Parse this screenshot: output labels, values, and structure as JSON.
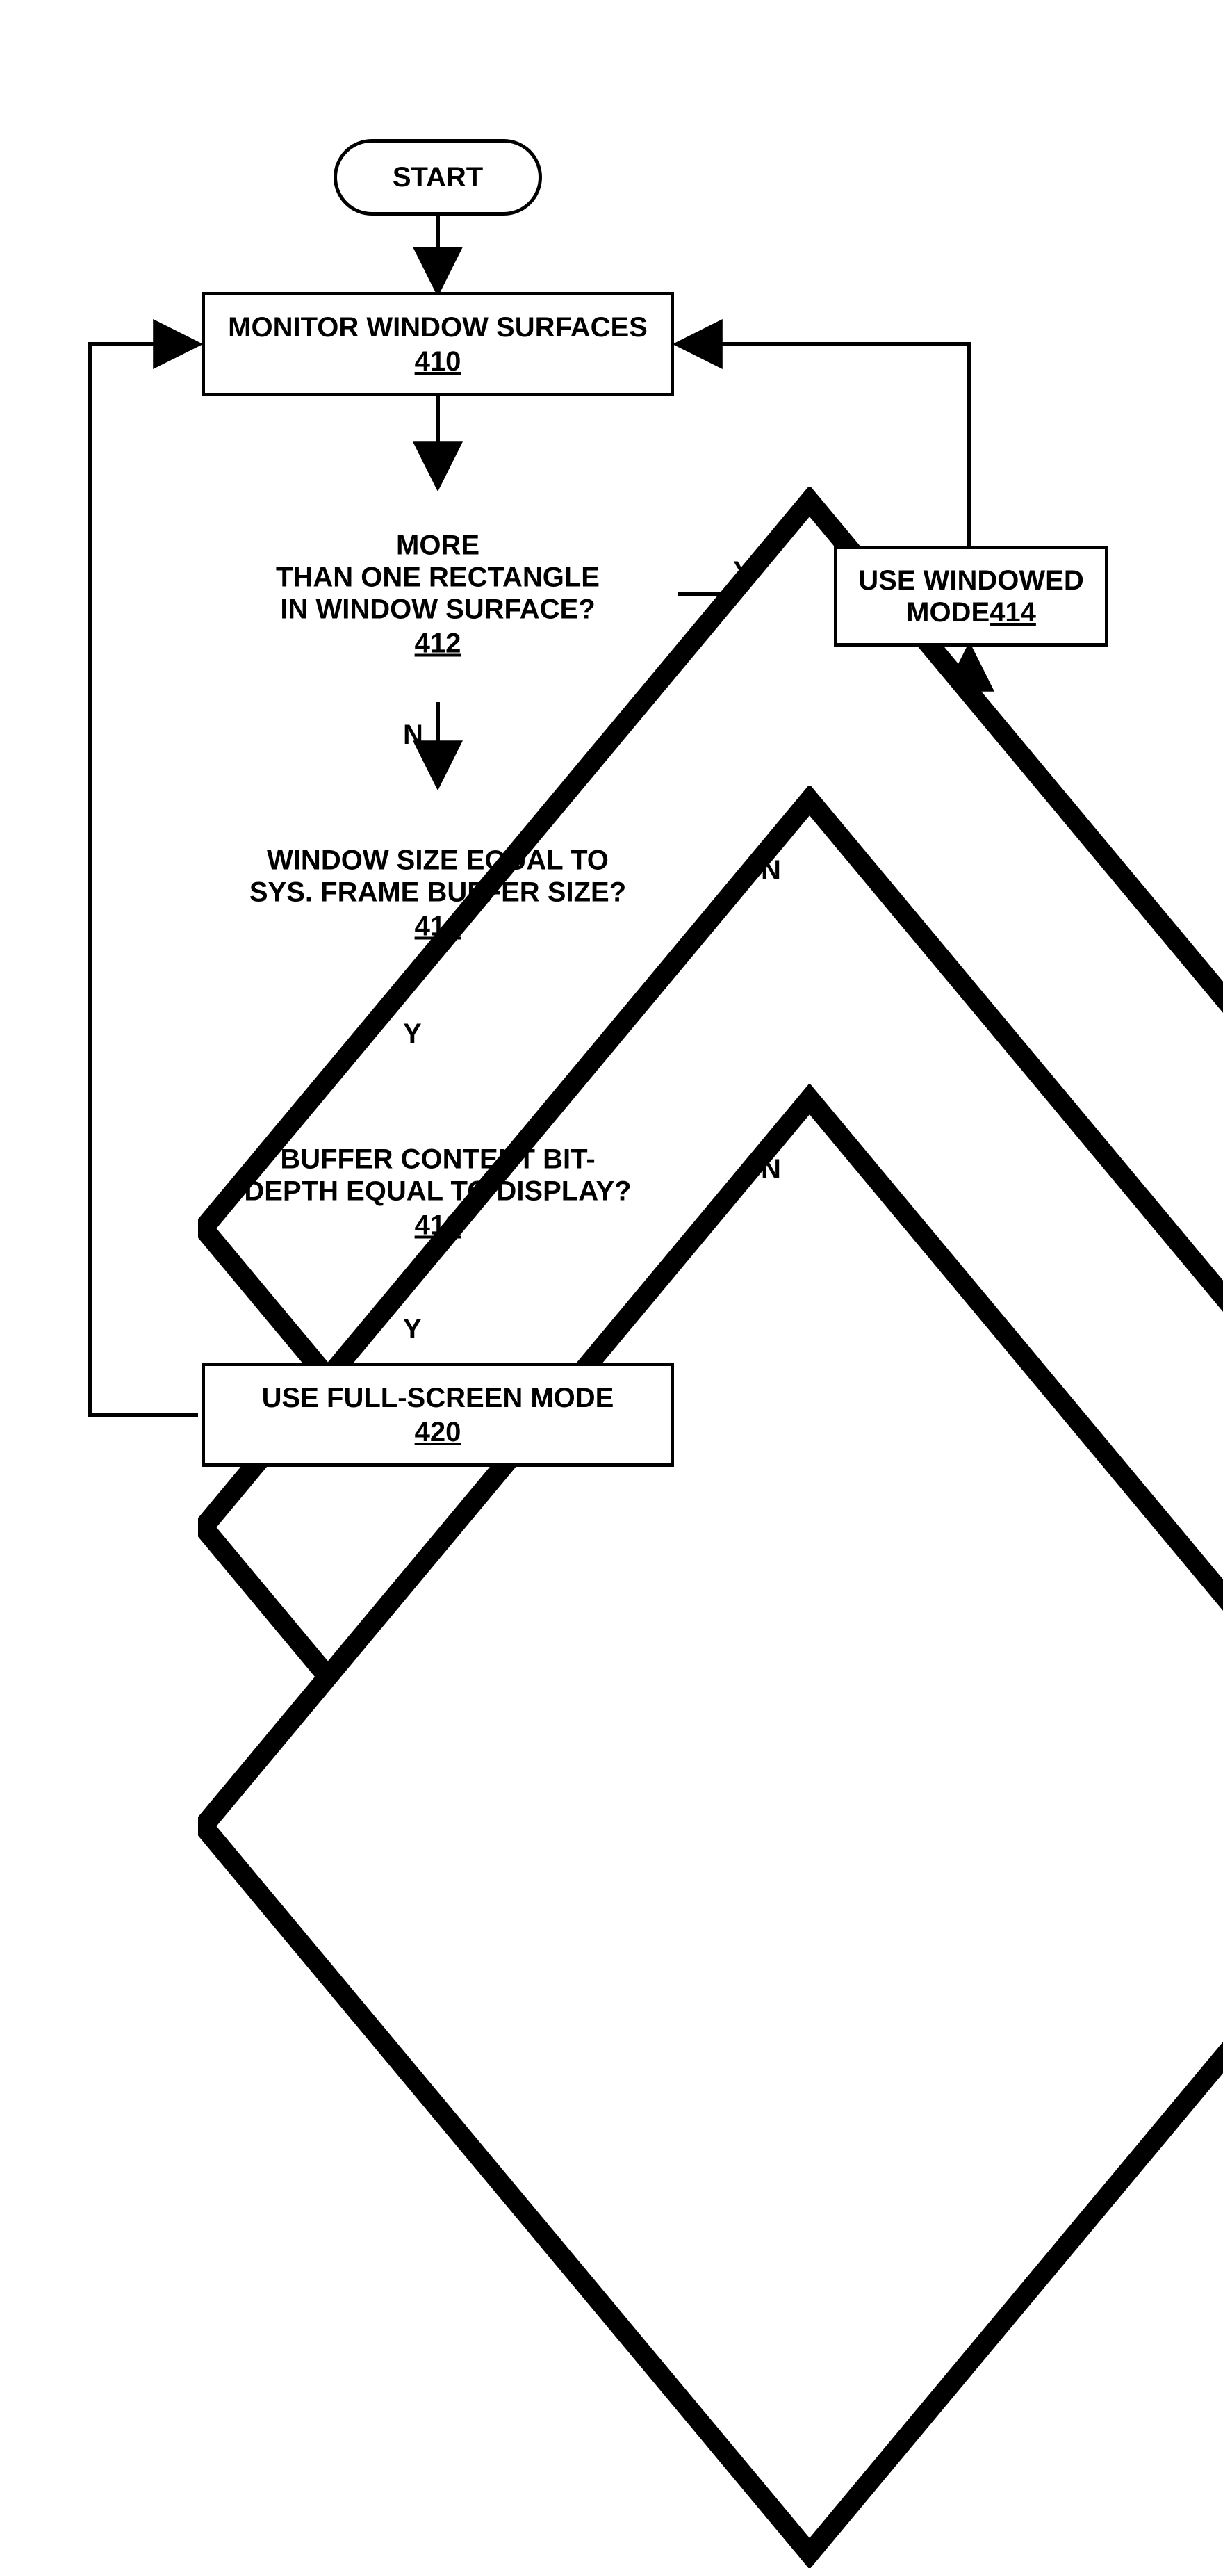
{
  "nodes": {
    "start": {
      "label": "START"
    },
    "monitor": {
      "label": "MONITOR WINDOW SURFACES",
      "ref": "410"
    },
    "d1": {
      "l1": "MORE",
      "l2": "THAN ONE RECTANGLE",
      "l3": "IN WINDOW SURFACE?",
      "ref": "412"
    },
    "d2": {
      "l1": "WINDOW SIZE EQUAL TO",
      "l2": "SYS. FRAME BUFFER SIZE?",
      "ref": "416"
    },
    "d3": {
      "l1": "BUFFER CONTENT BIT-",
      "l2": "DEPTH EQUAL TO DISPLAY?",
      "ref": "418"
    },
    "windowed": {
      "l1": "USE WINDOWED",
      "l2": "MODE ",
      "ref": "414"
    },
    "fullscreen": {
      "label": "USE FULL-SCREEN MODE",
      "ref": "420"
    }
  },
  "edges": {
    "y": "Y",
    "n": "N"
  }
}
